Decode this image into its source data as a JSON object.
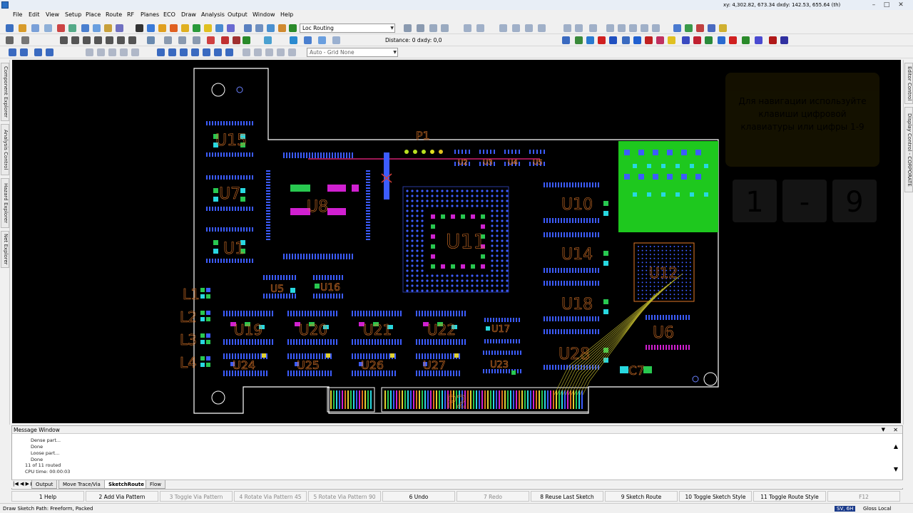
{
  "window": {
    "minimize": "–",
    "maximize": "□",
    "close": "✕"
  },
  "menu": [
    "File",
    "Edit",
    "View",
    "Setup",
    "Place",
    "Route",
    "RF",
    "Planes",
    "ECO",
    "Draw",
    "Analysis",
    "Output",
    "Window",
    "Help"
  ],
  "coords": "xy: 4,302.82, 673.34  dxdy: 142.53, 655.64  (th)",
  "toolbar": {
    "mode_combo": "Loc Routing",
    "distance": "Distance: 0  dxdy: 0,0",
    "grid_combo": "Auto - Grid None"
  },
  "left_tabs": [
    "Component Explorer",
    "Analysis Control",
    "Hazard Explorer",
    "Net Explorer"
  ],
  "right_tabs": [
    "Editor Control",
    "Display Control - CORPORATE"
  ],
  "board": {
    "refdes": {
      "U15": "U15",
      "U7": "U7",
      "U1": "U1",
      "U8": "U8",
      "P1": "P1",
      "U11": "U11",
      "U10": "U10",
      "U14": "U14",
      "U18": "U18",
      "U28": "U28",
      "U12": "U12",
      "U6": "U6",
      "C7": "C7",
      "P2": "P2",
      "U5": "U5",
      "U16": "U16",
      "U17": "U17",
      "U23": "U23",
      "L1": "L1",
      "L2": "L2",
      "L3": "L3",
      "L4": "L4",
      "U2": "U2",
      "U3": "U3",
      "U4": "U4",
      "U5b": "U5",
      "U19": "U19",
      "U20": "U20",
      "U21": "U21",
      "U22": "U22",
      "U24": "U24",
      "U25": "U25",
      "U26": "U26",
      "U27": "U27"
    },
    "overlay_text": [
      "Для навигации используйте",
      "клавиши цифровой",
      "клавиатуры или цифры 1-9"
    ],
    "overlay_nums": [
      "1",
      "-",
      "9"
    ]
  },
  "message_window": {
    "title": "Message Window",
    "lines": [
      "Dense part...",
      "Done",
      "Loose part...",
      "Done",
      "11 of 11 routed",
      "CPU time: 00:00:03"
    ]
  },
  "message_tabs": [
    "Output",
    "Move Trace/Via",
    "SketchRoute",
    "Flow"
  ],
  "fkeys": [
    {
      "label": "1 Help",
      "dim": false
    },
    {
      "label": "2 Add Via Pattern",
      "dim": false
    },
    {
      "label": "3 Toggle Via Pattern",
      "dim": true
    },
    {
      "label": "4 Rotate Via Pattern 45",
      "dim": true
    },
    {
      "label": "5 Rotate Via Pattern 90",
      "dim": true
    },
    {
      "label": "6 Undo",
      "dim": false
    },
    {
      "label": "7 Redo",
      "dim": true
    },
    {
      "label": "8 Reuse Last Sketch",
      "dim": false
    },
    {
      "label": "9 Sketch Route",
      "dim": false
    },
    {
      "label": "10 Toggle Sketch Style",
      "dim": false
    },
    {
      "label": "11 Toggle Route Style",
      "dim": false
    },
    {
      "label": "F12",
      "dim": true
    }
  ],
  "status": {
    "left": "Draw Sketch Path: Freeform, Packed",
    "layer": "SV, 6H",
    "gloss": "Gloss Local"
  },
  "colors": {
    "board_bg": "#000000",
    "outline": "#ffffff",
    "refdes": "#e0782a",
    "pad_blue": "#3c5cff",
    "pad_green": "#28c850",
    "pad_cyan": "#28d8e0",
    "pad_magenta": "#d020d0",
    "green_region": "#1ec81e"
  }
}
